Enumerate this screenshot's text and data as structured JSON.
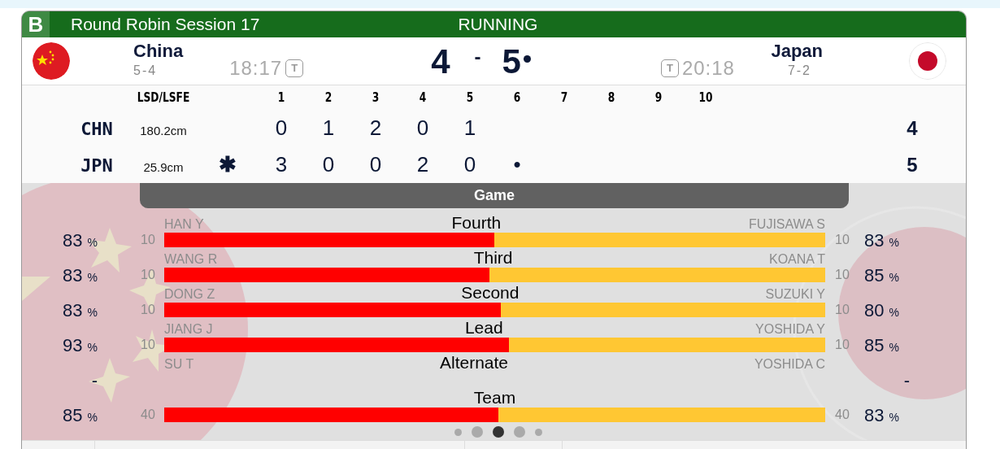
{
  "header": {
    "logo": "B",
    "title": "Round Robin Session 17",
    "status": "RUNNING"
  },
  "score_separator": "-",
  "teams": [
    {
      "name": "China",
      "record": "5-4",
      "clock": "18:17",
      "timeout": "T",
      "score": "4",
      "hammer": false,
      "code": "CHN",
      "lsd": "180.2cm",
      "ends": [
        "0",
        "1",
        "2",
        "0",
        "1"
      ],
      "total": "4"
    },
    {
      "name": "Japan",
      "record": "7-2",
      "clock": "20:18",
      "timeout": "T",
      "score": "5",
      "hammer": true,
      "code": "JPN",
      "lsd": "25.9cm",
      "lsfe_mark": "✱",
      "ends": [
        "3",
        "0",
        "0",
        "2",
        "0",
        "•"
      ],
      "total": "5"
    }
  ],
  "linescore": {
    "lsd_heading": "LSD/LSFE",
    "end_numbers": [
      "1",
      "2",
      "3",
      "4",
      "5",
      "6",
      "7",
      "8",
      "9",
      "10"
    ]
  },
  "stats": {
    "heading": "Game",
    "rows": [
      {
        "position": "Fourth",
        "level": 0.499,
        "left": {
          "name": "HAN Y",
          "shots": "10",
          "pct": "83",
          "unit": "%"
        },
        "right": {
          "name": "FUJISAWA S",
          "shots": "10",
          "pct": "83",
          "unit": "%"
        }
      },
      {
        "position": "Third",
        "level": 0.492,
        "left": {
          "name": "WANG R",
          "shots": "10",
          "pct": "83",
          "unit": "%"
        },
        "right": {
          "name": "KOANA T",
          "shots": "10",
          "pct": "85",
          "unit": "%"
        }
      },
      {
        "position": "Second",
        "level": 0.509,
        "left": {
          "name": "DONG Z",
          "shots": "10",
          "pct": "83",
          "unit": "%"
        },
        "right": {
          "name": "SUZUKI Y",
          "shots": "10",
          "pct": "80",
          "unit": "%"
        }
      },
      {
        "position": "Lead",
        "level": 0.522,
        "left": {
          "name": "JIANG J",
          "shots": "10",
          "pct": "93",
          "unit": "%"
        },
        "right": {
          "name": "YOSHIDA Y",
          "shots": "10",
          "pct": "85",
          "unit": "%"
        }
      },
      {
        "position": "Alternate",
        "left": {
          "name": "SU T",
          "pct": "-"
        },
        "right": {
          "name": "YOSHIDA C",
          "pct": "-"
        }
      },
      {
        "position": "Team",
        "level": 0.506,
        "left": {
          "shots": "40",
          "pct": "85",
          "unit": "%"
        },
        "right": {
          "shots": "40",
          "pct": "83",
          "unit": "%"
        }
      }
    ]
  },
  "pager": [
    {
      "selected": false
    },
    {
      "selected": false
    },
    {
      "selected": true
    },
    {
      "selected": false
    },
    {
      "selected": false
    }
  ]
}
